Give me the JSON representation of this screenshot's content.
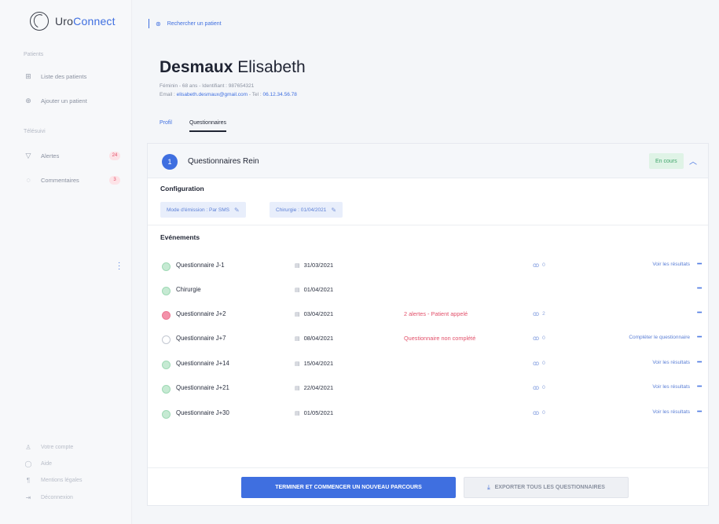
{
  "app": {
    "brand_prefix": "Uro",
    "brand_suffix": "Connect"
  },
  "sidebar": {
    "section_patients": "Patients",
    "items_patients": [
      {
        "label": "Liste des patients",
        "icon": "patient-list-icon"
      },
      {
        "label": "Ajouter un patient",
        "icon": "add-patient-icon"
      }
    ],
    "section_telesuivi": "Télésuivi",
    "items_telesuivi": [
      {
        "label": "Alertes",
        "badge": "24",
        "icon": "alert-icon"
      },
      {
        "label": "Commentaires",
        "badge": "3",
        "icon": "comment-icon"
      }
    ],
    "bottom_items": [
      {
        "label": "Votre compte",
        "icon": "account-icon"
      },
      {
        "label": "Aide",
        "icon": "help-icon"
      },
      {
        "label": "Mentions légales",
        "icon": "legal-icon"
      },
      {
        "label": "Déconnexion",
        "icon": "logout-icon"
      }
    ]
  },
  "topbar": {
    "search_label": "Rechercher un patient"
  },
  "patient": {
    "last_name": "Desmaux",
    "first_name": "Elisabeth",
    "meta_line": "Féminin - 68 ans - Identifiant : 987654321",
    "email_label": "Email : ",
    "email": "elisabeth.desmaux@gmail.com",
    "tel_label": " - Tel : ",
    "tel": "06.12.34.56.78"
  },
  "tabs": [
    {
      "label": "Profil",
      "active": false
    },
    {
      "label": "Questionnaires",
      "active": true
    }
  ],
  "card": {
    "number": "1",
    "title": "Questionnaires Rein",
    "status": "En cours",
    "configuration_label": "Configuration",
    "chips": [
      "Mode d'émission : Par SMS",
      "Chirurgie : 01/04/2021"
    ],
    "events_label": "Evénements",
    "events": [
      {
        "name": "Questionnaire J-1",
        "date": "31/03/2021",
        "alert": "",
        "comments": "0",
        "action": "Voir les résultats",
        "state": "done"
      },
      {
        "name": "Chirurgie",
        "date": "01/04/2021",
        "alert": "",
        "comments": "",
        "action": "",
        "state": "done"
      },
      {
        "name": "Questionnaire J+2",
        "date": "03/04/2021",
        "alert": "2 alertes - Patient appelé",
        "comments": "2",
        "action": "",
        "state": "alert"
      },
      {
        "name": "Questionnaire J+7",
        "date": "08/04/2021",
        "alert": "Questionnaire non complété",
        "comments": "0",
        "action": "Compléter le questionnaire",
        "state": "empty"
      },
      {
        "name": "Questionnaire J+14",
        "date": "15/04/2021",
        "alert": "",
        "comments": "0",
        "action": "Voir les résultats",
        "state": "done"
      },
      {
        "name": "Questionnaire J+21",
        "date": "22/04/2021",
        "alert": "",
        "comments": "0",
        "action": "Voir les résultats",
        "state": "done"
      },
      {
        "name": "Questionnaire J+30",
        "date": "01/05/2021",
        "alert": "",
        "comments": "0",
        "action": "Voir les résultats",
        "state": "done"
      }
    ],
    "more_label": "•••"
  },
  "footer": {
    "primary_label": "TERMINER ET COMMENCER UN NOUVEAU PARCOURS",
    "secondary_label": "EXPORTER TOUS LES QUESTIONNAIRES"
  },
  "colors": {
    "accent": "#3f6fe0",
    "alert": "#e2506a",
    "success": "#3fa56b"
  }
}
